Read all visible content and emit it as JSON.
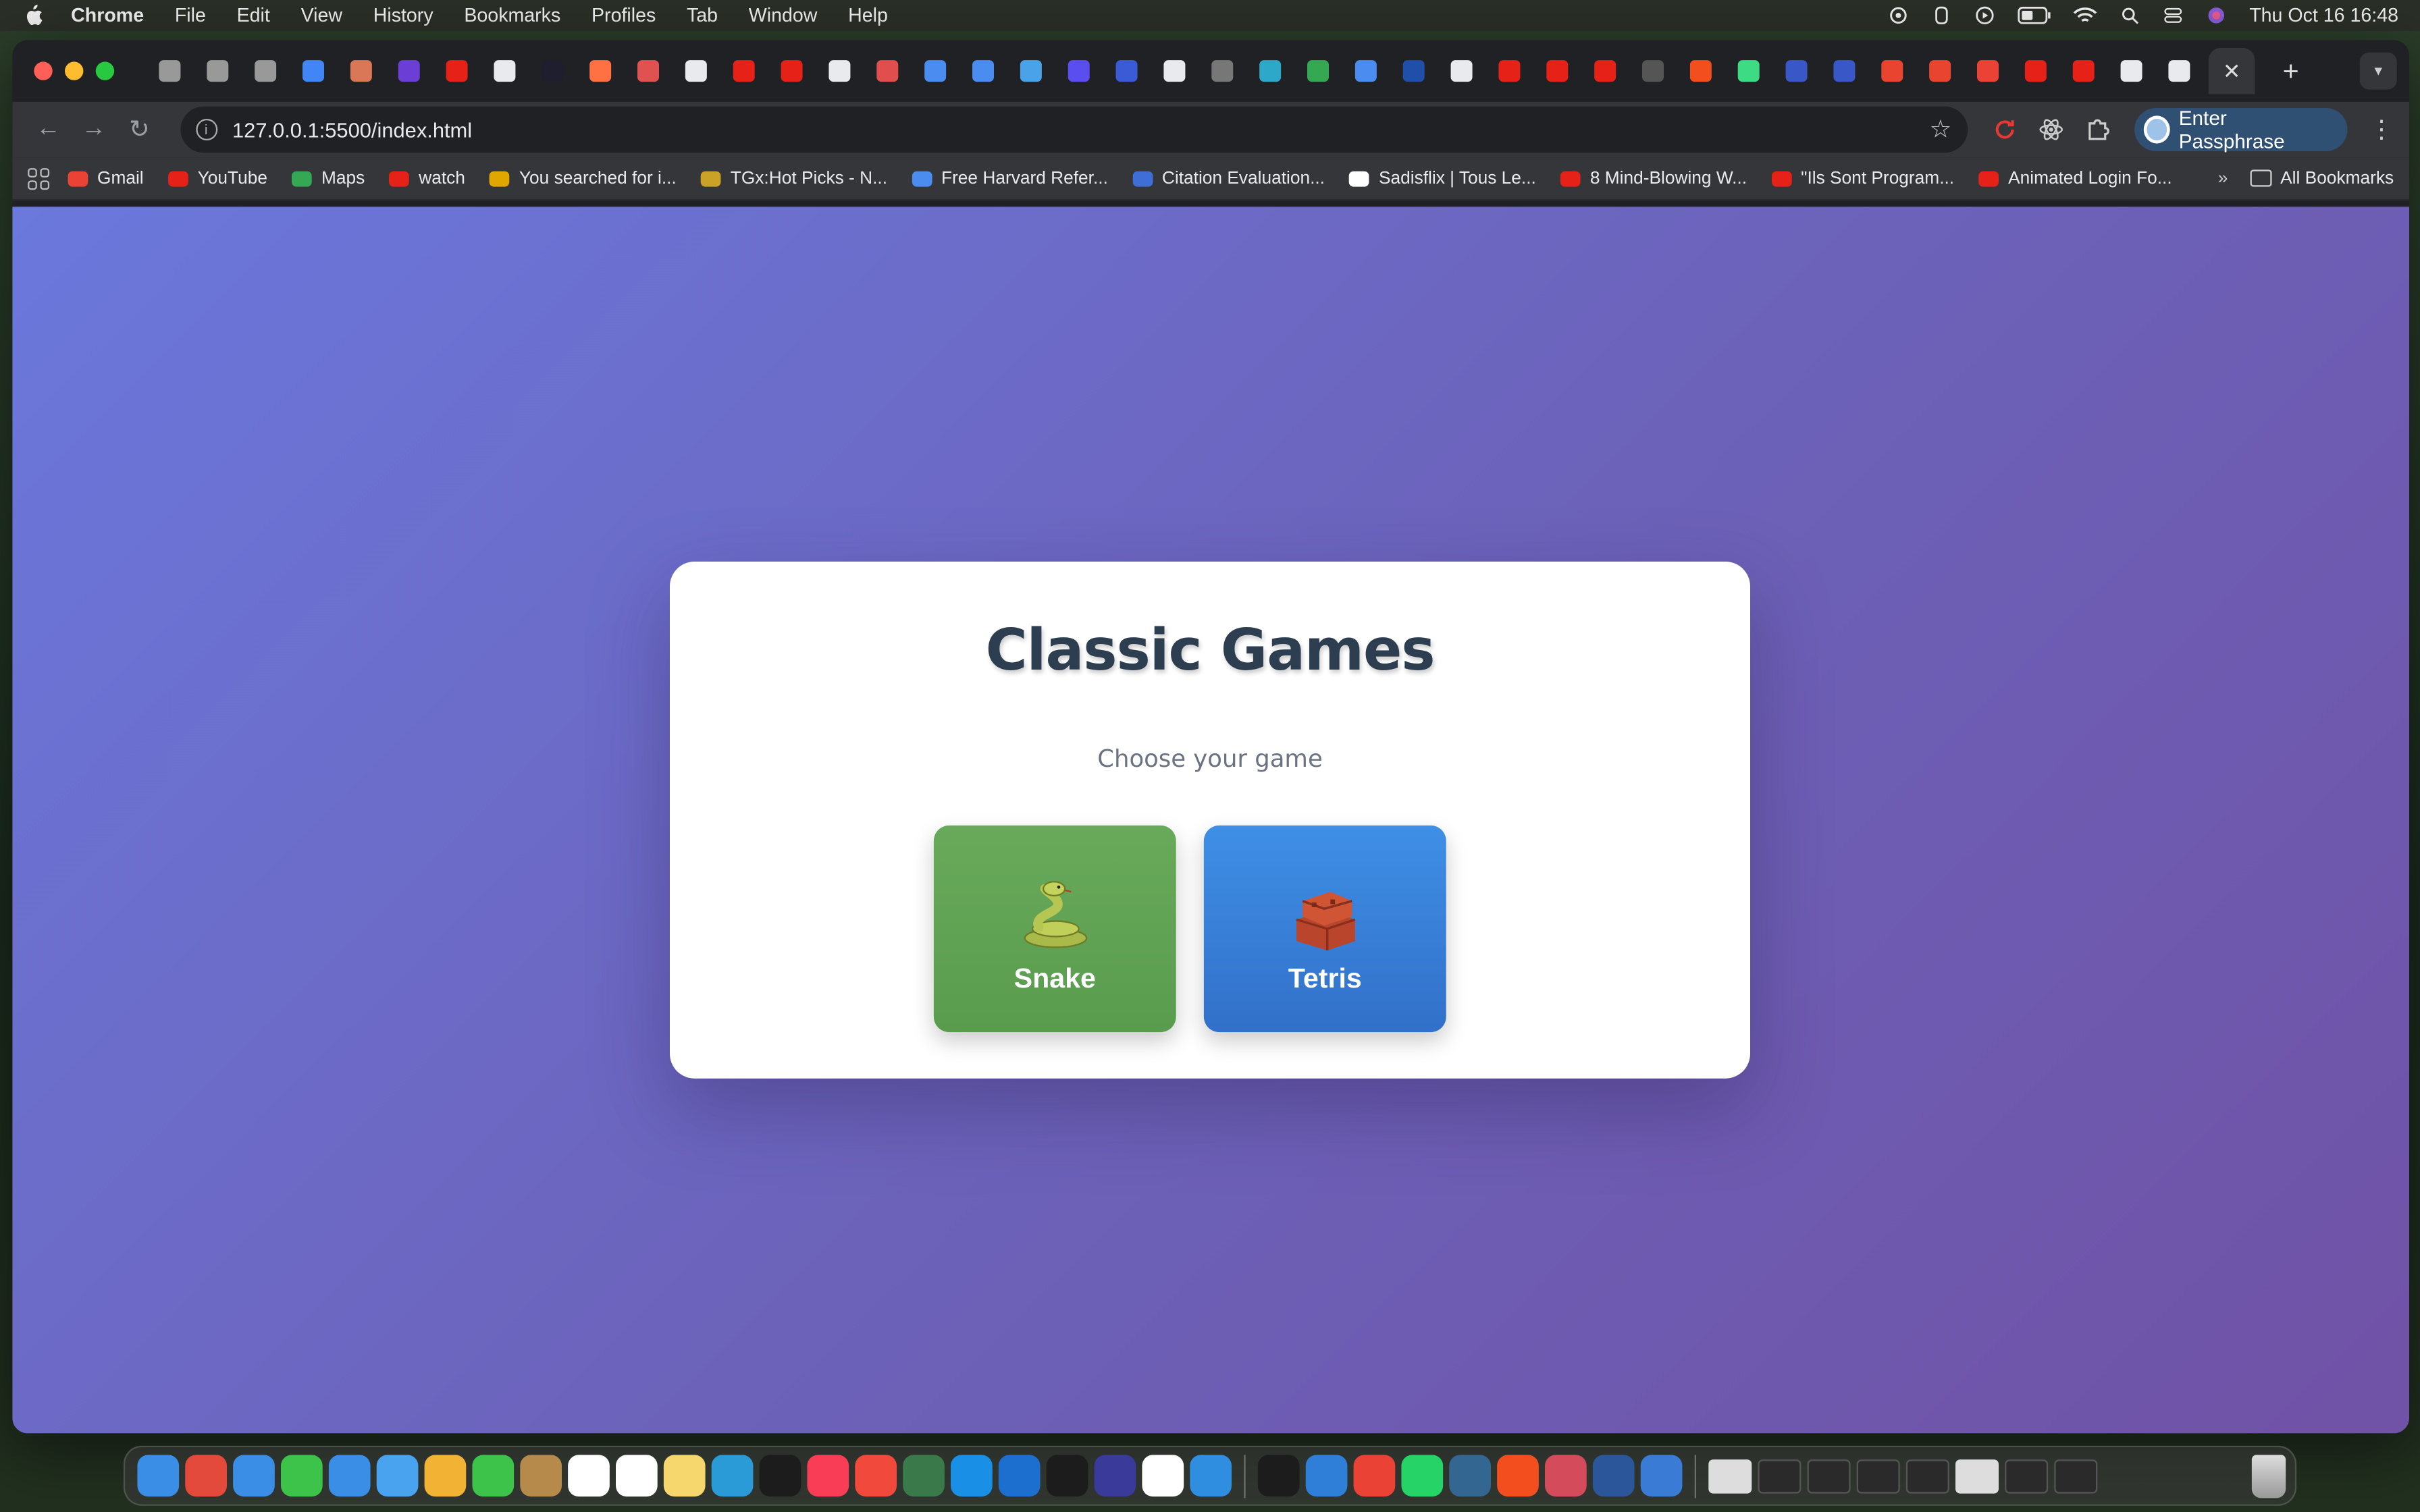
{
  "menubar": {
    "app_name": "Chrome",
    "items": [
      "File",
      "Edit",
      "View",
      "History",
      "Bookmarks",
      "Profiles",
      "Tab",
      "Window",
      "Help"
    ],
    "datetime": "Thu Oct 16  16:48"
  },
  "browser": {
    "url": "127.0.0.1:5500/index.html",
    "passphrase_label": "Enter Passphrase",
    "tab_favicon_colors": [
      "#999999",
      "#999999",
      "#999999",
      "#4285f4",
      "#d97757",
      "#6b3fd6",
      "#e62117",
      "#e8eaed",
      "#1e1e2e",
      "#ff7043",
      "#e05252",
      "#e8eaed",
      "#e62117",
      "#e62117",
      "#e8eaed",
      "#e04e4e",
      "#4a8cf0",
      "#4a8cf0",
      "#4aa3e8",
      "#5b4ef0",
      "#3b5bd6",
      "#e8eaed",
      "#777777",
      "#2ea8c8",
      "#34a853",
      "#4a8cf0",
      "#1f4fa8",
      "#e8eaed",
      "#e62117",
      "#e62117",
      "#e62117",
      "#555555",
      "#f24e1e",
      "#3ddc84",
      "#3a57c8",
      "#3a57c8",
      "#e8442f",
      "#e8442f",
      "#ea4335",
      "#e62117",
      "#e62117",
      "#e8eaed",
      "#e8eaed"
    ],
    "bookmarks": [
      {
        "label": "Gmail",
        "color": "#ea4335"
      },
      {
        "label": "YouTube",
        "color": "#e62117"
      },
      {
        "label": "Maps",
        "color": "#34a853"
      },
      {
        "label": "watch",
        "color": "#e62117"
      },
      {
        "label": "You searched for i...",
        "color": "#e0a700"
      },
      {
        "label": "TGx:Hot Picks - N...",
        "color": "#c9a227"
      },
      {
        "label": "Free Harvard Refer...",
        "color": "#4a8cf0"
      },
      {
        "label": "Citation Evaluation...",
        "color": "#3f6fd6"
      },
      {
        "label": "Sadisflix | Tous Le...",
        "color": "#ffffff"
      },
      {
        "label": "8 Mind-Blowing W...",
        "color": "#e62117"
      },
      {
        "label": "\"Ils Sont Program...",
        "color": "#e62117"
      },
      {
        "label": "Animated Login Fo...",
        "color": "#e62117"
      }
    ],
    "all_bookmarks_label": "All Bookmarks"
  },
  "page": {
    "title": "Classic Games",
    "subtitle": "Choose your game",
    "games": [
      {
        "label": "Snake",
        "icon": "snake-emoji-icon",
        "color": "#5fa352"
      },
      {
        "label": "Tetris",
        "icon": "bricks-emoji-icon",
        "color": "#3a80d9"
      }
    ]
  },
  "dock": {
    "app_colors": [
      "#3a8ee6",
      "#e34a3c",
      "#3a8ee6",
      "#3dc24a",
      "#3a8ee6",
      "#4aa3ef",
      "#f2b233",
      "#3dc24a",
      "#b58a4a",
      "#ffffff",
      "#ffffff",
      "#f5d76e",
      "#2b9bd8",
      "#1c1c1c",
      "#fa3d56",
      "#f14a3c",
      "#3a7a4a",
      "#1a8fe6",
      "#1c6fce",
      "#1c1c1c",
      "#3a3a9a",
      "#ffffff",
      "#2f8ee0"
    ],
    "app_colors_right": [
      "#1c1c1c",
      "#2f7ed8",
      "#ea4335",
      "#25d366",
      "#336791",
      "#f24e1e",
      "#d44b5c",
      "#2b579a",
      "#3a7bd5"
    ]
  }
}
